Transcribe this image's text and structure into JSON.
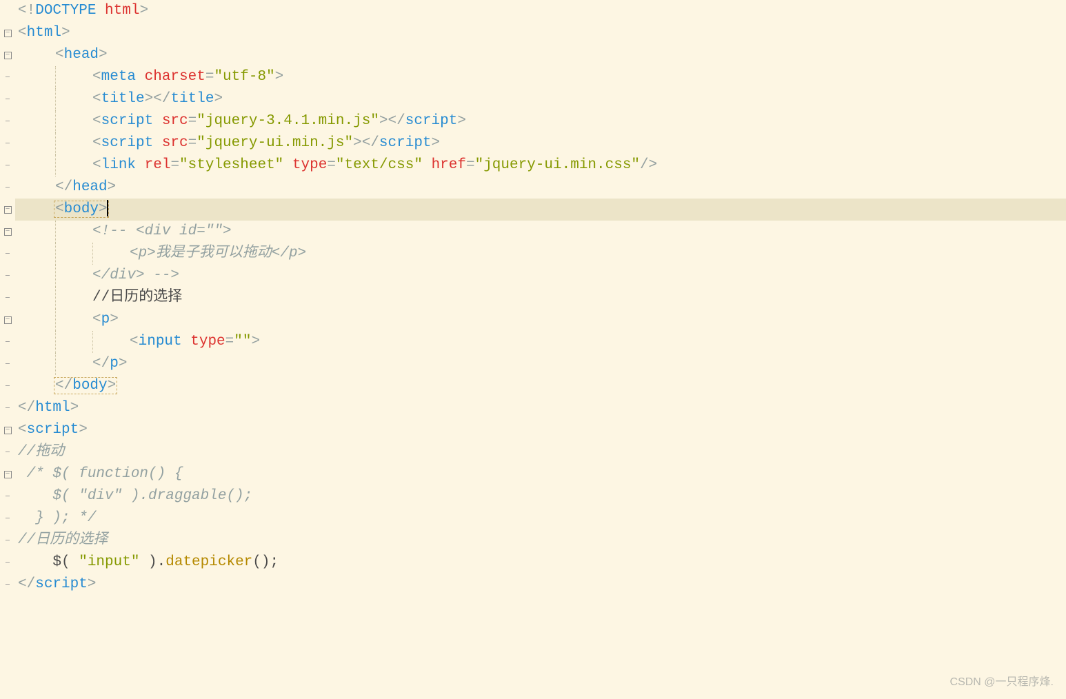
{
  "watermark": "CSDN @一只程序烽.",
  "gutter": {
    "minus": "⊟",
    "dash": "–"
  },
  "lines": [
    {
      "fold": "",
      "indent": 0,
      "guides": [],
      "tokens": [
        [
          "gray",
          "<!"
        ],
        [
          "blue",
          "DOCTYPE "
        ],
        [
          "red",
          "html"
        ],
        [
          "gray",
          ">"
        ]
      ]
    },
    {
      "fold": "minus",
      "indent": 0,
      "guides": [],
      "tokens": [
        [
          "gray",
          "<"
        ],
        [
          "blue",
          "html"
        ],
        [
          "gray",
          ">"
        ]
      ]
    },
    {
      "fold": "minus",
      "indent": 1,
      "guides": [],
      "tokens": [
        [
          "gray",
          "<"
        ],
        [
          "blue",
          "head"
        ],
        [
          "gray",
          ">"
        ]
      ]
    },
    {
      "fold": "dash",
      "indent": 2,
      "guides": [
        1
      ],
      "tokens": [
        [
          "gray",
          "<"
        ],
        [
          "blue",
          "meta "
        ],
        [
          "red",
          "charset"
        ],
        [
          "gray",
          "="
        ],
        [
          "green",
          "\"utf-8\""
        ],
        [
          "gray",
          ">"
        ]
      ]
    },
    {
      "fold": "dash",
      "indent": 2,
      "guides": [
        1
      ],
      "tokens": [
        [
          "gray",
          "<"
        ],
        [
          "blue",
          "title"
        ],
        [
          "gray",
          "></"
        ],
        [
          "blue",
          "title"
        ],
        [
          "gray",
          ">"
        ]
      ]
    },
    {
      "fold": "dash",
      "indent": 2,
      "guides": [
        1
      ],
      "tokens": [
        [
          "gray",
          "<"
        ],
        [
          "blue",
          "script "
        ],
        [
          "red",
          "src"
        ],
        [
          "gray",
          "="
        ],
        [
          "green",
          "\"jquery-3.4.1.min.js\""
        ],
        [
          "gray",
          "></"
        ],
        [
          "blue",
          "script"
        ],
        [
          "gray",
          ">"
        ]
      ]
    },
    {
      "fold": "dash",
      "indent": 2,
      "guides": [
        1
      ],
      "tokens": [
        [
          "gray",
          "<"
        ],
        [
          "blue",
          "script "
        ],
        [
          "red",
          "src"
        ],
        [
          "gray",
          "="
        ],
        [
          "green",
          "\"jquery-ui.min.js\""
        ],
        [
          "gray",
          "></"
        ],
        [
          "blue",
          "script"
        ],
        [
          "gray",
          ">"
        ]
      ]
    },
    {
      "fold": "dash",
      "indent": 2,
      "guides": [
        1
      ],
      "tokens": [
        [
          "gray",
          "<"
        ],
        [
          "blue",
          "link "
        ],
        [
          "red",
          "rel"
        ],
        [
          "gray",
          "="
        ],
        [
          "green",
          "\"stylesheet\""
        ],
        [
          "blue",
          " "
        ],
        [
          "red",
          "type"
        ],
        [
          "gray",
          "="
        ],
        [
          "green",
          "\"text/css\""
        ],
        [
          "blue",
          " "
        ],
        [
          "red",
          "href"
        ],
        [
          "gray",
          "="
        ],
        [
          "green",
          "\"jquery-ui.min.css\""
        ],
        [
          "gray",
          "/>"
        ]
      ]
    },
    {
      "fold": "dash",
      "indent": 1,
      "guides": [],
      "tokens": [
        [
          "gray",
          "</"
        ],
        [
          "blue",
          "head"
        ],
        [
          "gray",
          ">"
        ]
      ]
    },
    {
      "fold": "minus",
      "indent": 1,
      "guides": [],
      "current": true,
      "selbox": true,
      "cursor": true,
      "tokens": [
        [
          "gray",
          "<"
        ],
        [
          "blue",
          "body"
        ],
        [
          "gray",
          ">"
        ]
      ]
    },
    {
      "fold": "minus",
      "indent": 2,
      "guides": [
        1
      ],
      "tokens": [
        [
          "comment",
          "<!-- <div id=\"\">"
        ]
      ]
    },
    {
      "fold": "dash",
      "indent": 3,
      "guides": [
        1,
        2
      ],
      "tokens": [
        [
          "comment",
          "<p>我是子我可以拖动</p>"
        ]
      ]
    },
    {
      "fold": "dash",
      "indent": 2,
      "guides": [
        1
      ],
      "tokens": [
        [
          "comment",
          "</div> -->"
        ]
      ]
    },
    {
      "fold": "dash",
      "indent": 2,
      "guides": [
        1
      ],
      "tokens": [
        [
          "black",
          "//日历的选择"
        ]
      ]
    },
    {
      "fold": "minus",
      "indent": 2,
      "guides": [
        1
      ],
      "tokens": [
        [
          "gray",
          "<"
        ],
        [
          "blue",
          "p"
        ],
        [
          "gray",
          ">"
        ]
      ]
    },
    {
      "fold": "dash",
      "indent": 3,
      "guides": [
        1,
        2
      ],
      "tokens": [
        [
          "gray",
          "<"
        ],
        [
          "blue",
          "input "
        ],
        [
          "red",
          "type"
        ],
        [
          "gray",
          "="
        ],
        [
          "green",
          "\"\""
        ],
        [
          "gray",
          ">"
        ]
      ]
    },
    {
      "fold": "dash",
      "indent": 2,
      "guides": [
        1
      ],
      "tokens": [
        [
          "gray",
          "</"
        ],
        [
          "blue",
          "p"
        ],
        [
          "gray",
          ">"
        ]
      ]
    },
    {
      "fold": "dash",
      "indent": 1,
      "guides": [],
      "selbox": true,
      "tokens": [
        [
          "gray",
          "</"
        ],
        [
          "blue",
          "body"
        ],
        [
          "gray",
          ">"
        ]
      ]
    },
    {
      "fold": "dash",
      "indent": 0,
      "guides": [],
      "tokens": [
        [
          "gray",
          "</"
        ],
        [
          "blue",
          "html"
        ],
        [
          "gray",
          ">"
        ]
      ]
    },
    {
      "fold": "minus",
      "indent": 0,
      "guides": [],
      "tokens": [
        [
          "gray",
          "<"
        ],
        [
          "blue",
          "script"
        ],
        [
          "gray",
          ">"
        ]
      ]
    },
    {
      "fold": "dash",
      "indent": 0,
      "guides": [],
      "tokens": [
        [
          "comment",
          "//拖动"
        ]
      ]
    },
    {
      "fold": "minus",
      "indent": 0,
      "guides": [],
      "tokens": [
        [
          "comment",
          " /* $( function() {"
        ]
      ]
    },
    {
      "fold": "dash",
      "indent": 0,
      "guides": [],
      "tokens": [
        [
          "comment",
          "    $( \"div\" ).draggable();"
        ]
      ]
    },
    {
      "fold": "dash",
      "indent": 0,
      "guides": [],
      "tokens": [
        [
          "comment",
          "  } ); */"
        ]
      ]
    },
    {
      "fold": "dash",
      "indent": 0,
      "guides": [],
      "tokens": [
        [
          "comment",
          "//日历的选择"
        ]
      ]
    },
    {
      "fold": "dash",
      "indent": 0,
      "guides": [],
      "tokens": [
        [
          "black",
          "    $( "
        ],
        [
          "green",
          "\"input\""
        ],
        [
          "black",
          " )."
        ],
        [
          "method",
          "datepicker"
        ],
        [
          "black",
          "();"
        ]
      ]
    },
    {
      "fold": "dash",
      "indent": 0,
      "guides": [],
      "tokens": [
        [
          "gray",
          "</"
        ],
        [
          "blue",
          "script"
        ],
        [
          "gray",
          ">"
        ]
      ]
    }
  ]
}
